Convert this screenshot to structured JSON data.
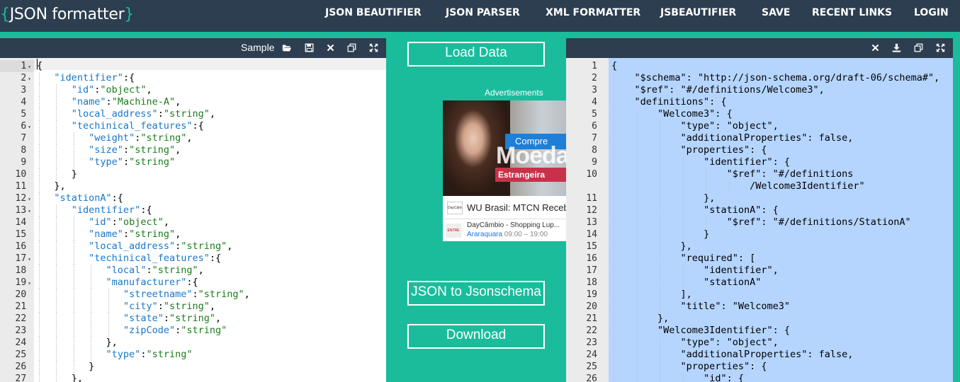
{
  "logo": {
    "open": "{",
    "text": "JSON formatter",
    "close": "}"
  },
  "nav": [
    "JSON BEAUTIFIER",
    "JSON PARSER",
    "XML FORMATTER",
    "JSBEAUTIFIER",
    "SAVE",
    "RECENT LINKS",
    "LOGIN"
  ],
  "left_pane": {
    "sample_label": "Sample",
    "toolbar_icons": [
      "folder-open-icon",
      "save-icon",
      "close-icon",
      "copy-icon",
      "fullscreen-icon"
    ],
    "lines": [
      {
        "n": "1",
        "fold": true,
        "indent": 0,
        "parts": [
          [
            "p",
            "{"
          ]
        ]
      },
      {
        "n": "2",
        "fold": true,
        "indent": 1,
        "parts": [
          [
            "k",
            "\"identifier\""
          ],
          [
            "p",
            ":{"
          ]
        ]
      },
      {
        "n": "3",
        "fold": false,
        "indent": 2,
        "parts": [
          [
            "k",
            "\"id\""
          ],
          [
            "p",
            ":"
          ],
          [
            "s",
            "\"object\""
          ],
          [
            "p",
            ","
          ]
        ]
      },
      {
        "n": "4",
        "fold": false,
        "indent": 2,
        "parts": [
          [
            "k",
            "\"name\""
          ],
          [
            "p",
            ":"
          ],
          [
            "s",
            "\"Machine-A\""
          ],
          [
            "p",
            ","
          ]
        ]
      },
      {
        "n": "5",
        "fold": false,
        "indent": 2,
        "parts": [
          [
            "k",
            "\"local_address\""
          ],
          [
            "p",
            ":"
          ],
          [
            "s",
            "\"string\""
          ],
          [
            "p",
            ","
          ]
        ]
      },
      {
        "n": "6",
        "fold": true,
        "indent": 2,
        "parts": [
          [
            "k",
            "\"techinical_features\""
          ],
          [
            "p",
            ":{"
          ]
        ]
      },
      {
        "n": "7",
        "fold": false,
        "indent": 3,
        "parts": [
          [
            "k",
            "\"weight\""
          ],
          [
            "p",
            ":"
          ],
          [
            "s",
            "\"string\""
          ],
          [
            "p",
            ","
          ]
        ]
      },
      {
        "n": "8",
        "fold": false,
        "indent": 3,
        "parts": [
          [
            "k",
            "\"size\""
          ],
          [
            "p",
            ":"
          ],
          [
            "s",
            "\"string\""
          ],
          [
            "p",
            ","
          ]
        ]
      },
      {
        "n": "9",
        "fold": false,
        "indent": 3,
        "parts": [
          [
            "k",
            "\"type\""
          ],
          [
            "p",
            ":"
          ],
          [
            "s",
            "\"string\""
          ]
        ]
      },
      {
        "n": "10",
        "fold": false,
        "indent": 2,
        "parts": [
          [
            "p",
            "}"
          ]
        ]
      },
      {
        "n": "11",
        "fold": false,
        "indent": 1,
        "parts": [
          [
            "p",
            "},"
          ]
        ]
      },
      {
        "n": "12",
        "fold": true,
        "indent": 1,
        "parts": [
          [
            "k",
            "\"stationA\""
          ],
          [
            "p",
            ":{"
          ]
        ]
      },
      {
        "n": "13",
        "fold": true,
        "indent": 2,
        "parts": [
          [
            "k",
            "\"identifier\""
          ],
          [
            "p",
            ":{"
          ]
        ]
      },
      {
        "n": "14",
        "fold": false,
        "indent": 3,
        "parts": [
          [
            "k",
            "\"id\""
          ],
          [
            "p",
            ":"
          ],
          [
            "s",
            "\"object\""
          ],
          [
            "p",
            ","
          ]
        ]
      },
      {
        "n": "15",
        "fold": false,
        "indent": 3,
        "parts": [
          [
            "k",
            "\"name\""
          ],
          [
            "p",
            ":"
          ],
          [
            "s",
            "\"string\""
          ],
          [
            "p",
            ","
          ]
        ]
      },
      {
        "n": "16",
        "fold": false,
        "indent": 3,
        "parts": [
          [
            "k",
            "\"local_address\""
          ],
          [
            "p",
            ":"
          ],
          [
            "s",
            "\"string\""
          ],
          [
            "p",
            ","
          ]
        ]
      },
      {
        "n": "17",
        "fold": true,
        "indent": 3,
        "parts": [
          [
            "k",
            "\"techinical_features\""
          ],
          [
            "p",
            ":{"
          ]
        ]
      },
      {
        "n": "18",
        "fold": false,
        "indent": 4,
        "parts": [
          [
            "k",
            "\"local\""
          ],
          [
            "p",
            ":"
          ],
          [
            "s",
            "\"string\""
          ],
          [
            "p",
            ","
          ]
        ]
      },
      {
        "n": "19",
        "fold": true,
        "indent": 4,
        "parts": [
          [
            "k",
            "\"manufacturer\""
          ],
          [
            "p",
            ":{"
          ]
        ]
      },
      {
        "n": "20",
        "fold": false,
        "indent": 5,
        "parts": [
          [
            "k",
            "\"streetname\""
          ],
          [
            "p",
            ":"
          ],
          [
            "s",
            "\"string\""
          ],
          [
            "p",
            ","
          ]
        ]
      },
      {
        "n": "21",
        "fold": false,
        "indent": 5,
        "parts": [
          [
            "k",
            "\"city\""
          ],
          [
            "p",
            ":"
          ],
          [
            "s",
            "\"string\""
          ],
          [
            "p",
            ","
          ]
        ]
      },
      {
        "n": "22",
        "fold": false,
        "indent": 5,
        "parts": [
          [
            "k",
            "\"state\""
          ],
          [
            "p",
            ":"
          ],
          [
            "s",
            "\"string\""
          ],
          [
            "p",
            ","
          ]
        ]
      },
      {
        "n": "23",
        "fold": false,
        "indent": 5,
        "parts": [
          [
            "k",
            "\"zipCode\""
          ],
          [
            "p",
            ":"
          ],
          [
            "s",
            "\"string\""
          ]
        ]
      },
      {
        "n": "24",
        "fold": false,
        "indent": 4,
        "parts": [
          [
            "p",
            "},"
          ]
        ]
      },
      {
        "n": "25",
        "fold": false,
        "indent": 4,
        "parts": [
          [
            "k",
            "\"type\""
          ],
          [
            "p",
            ":"
          ],
          [
            "s",
            "\"string\""
          ]
        ]
      },
      {
        "n": "26",
        "fold": false,
        "indent": 3,
        "parts": [
          [
            "p",
            "}"
          ]
        ]
      },
      {
        "n": "27",
        "fold": false,
        "indent": 2,
        "parts": [
          [
            "p",
            "},"
          ]
        ]
      }
    ]
  },
  "middle": {
    "load_button": "Load Data",
    "ad_label": "Advertisements",
    "ad": {
      "banner_button": "Compre",
      "banner_big": "Moeda",
      "banner_strip": "Estrangeira",
      "logo1": "DayCâmbio",
      "title1": "WU Brasil: MTCN Recebimento",
      "logo2": "ENTRE",
      "title2": "DayCâmbio - Shopping Lup...",
      "city": "Araraquara",
      "hours": " 09:00 – 19:00"
    },
    "schema_button": "JSON to Jsonschema",
    "download_button": "Download"
  },
  "right_pane": {
    "toolbar_icons": [
      "close-icon",
      "download-icon",
      "copy-icon",
      "fullscreen-icon"
    ],
    "lines": [
      {
        "n": "1",
        "indent": 0,
        "text": "{"
      },
      {
        "n": "2",
        "indent": 1,
        "text": "\"$schema\": \"http://json-schema.org/draft-06/schema#\","
      },
      {
        "n": "3",
        "indent": 1,
        "text": "\"$ref\": \"#/definitions/Welcome3\","
      },
      {
        "n": "4",
        "indent": 1,
        "text": "\"definitions\": {"
      },
      {
        "n": "5",
        "indent": 2,
        "text": "\"Welcome3\": {"
      },
      {
        "n": "6",
        "indent": 3,
        "text": "\"type\": \"object\","
      },
      {
        "n": "7",
        "indent": 3,
        "text": "\"additionalProperties\": false,"
      },
      {
        "n": "8",
        "indent": 3,
        "text": "\"properties\": {"
      },
      {
        "n": "9",
        "indent": 4,
        "text": "\"identifier\": {"
      },
      {
        "n": "10",
        "indent": 5,
        "text": "\"$ref\": \"#/definitions"
      },
      {
        "n": "",
        "indent": 6,
        "text": "/Welcome3Identifier\""
      },
      {
        "n": "11",
        "indent": 4,
        "text": "},"
      },
      {
        "n": "12",
        "indent": 4,
        "text": "\"stationA\": {"
      },
      {
        "n": "13",
        "indent": 5,
        "text": "\"$ref\": \"#/definitions/StationA\""
      },
      {
        "n": "14",
        "indent": 4,
        "text": "}"
      },
      {
        "n": "15",
        "indent": 3,
        "text": "},"
      },
      {
        "n": "16",
        "indent": 3,
        "text": "\"required\": ["
      },
      {
        "n": "17",
        "indent": 4,
        "text": "\"identifier\","
      },
      {
        "n": "18",
        "indent": 4,
        "text": "\"stationA\""
      },
      {
        "n": "19",
        "indent": 3,
        "text": "],"
      },
      {
        "n": "20",
        "indent": 3,
        "text": "\"title\": \"Welcome3\""
      },
      {
        "n": "21",
        "indent": 2,
        "text": "},"
      },
      {
        "n": "22",
        "indent": 2,
        "text": "\"Welcome3Identifier\": {"
      },
      {
        "n": "23",
        "indent": 3,
        "text": "\"type\": \"object\","
      },
      {
        "n": "24",
        "indent": 3,
        "text": "\"additionalProperties\": false,"
      },
      {
        "n": "25",
        "indent": 3,
        "text": "\"properties\": {"
      },
      {
        "n": "26",
        "indent": 4,
        "text": "\"id\": {"
      }
    ]
  }
}
